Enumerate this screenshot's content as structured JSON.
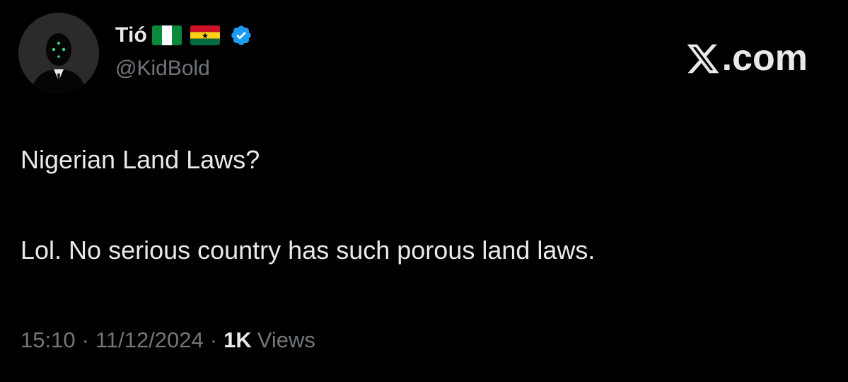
{
  "author": {
    "display_name": "Tió",
    "handle": "@KidBold",
    "flags": [
      "nigeria-flag-icon",
      "ghana-flag-icon"
    ],
    "verified": true
  },
  "brand": {
    "label": ".com"
  },
  "post": {
    "line1": "Nigerian Land Laws?",
    "line2": "Lol. No serious country has such porous land laws."
  },
  "meta": {
    "time": "15:10",
    "separator": "·",
    "date": "11/12/2024",
    "views_count": "1K",
    "views_label": "Views"
  },
  "colors": {
    "background": "#000000",
    "text_primary": "#e7e9ea",
    "text_secondary": "#71767b",
    "verified_blue": "#1d9bf0"
  }
}
